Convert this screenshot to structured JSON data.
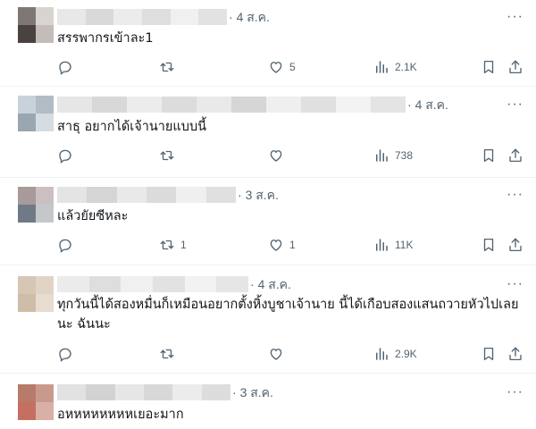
{
  "posts": [
    {
      "time": "4 ส.ค.",
      "text": "สรรพากรเข้าละ1",
      "replies": "",
      "reposts": "",
      "likes": "5",
      "views": "2.1K",
      "avatar_colors": [
        "#7f7774",
        "#d8d4cf",
        "#4b423f",
        "#c3bcb8"
      ]
    },
    {
      "time": "4 ส.ค.",
      "text": "สาธุ อยากได้เจ้านายแบบนี้",
      "replies": "",
      "reposts": "",
      "likes": "",
      "views": "738",
      "avatar_colors": [
        "#c9d2d9",
        "#b2bcc4",
        "#9aa6b0",
        "#d6dde2"
      ]
    },
    {
      "time": "3 ส.ค.",
      "text": "แล้วยัยซีหละ",
      "replies": "",
      "reposts": "1",
      "likes": "1",
      "views": "11K",
      "avatar_colors": [
        "#a79a98",
        "#cbbfc1",
        "#707a86",
        "#c5c8cb"
      ]
    },
    {
      "time": "4 ส.ค.",
      "text_lines": [
        "ทุกวันนี้ได้สองหมื่นก็เหมือนอยากตั้งหิ้งบูชาเจ้านาย นี้ได้เกือบสองแสนถวายหัวไปเลย",
        "นะ ฉันนะ"
      ],
      "replies": "",
      "reposts": "",
      "likes": "",
      "views": "2.9K",
      "avatar_colors": [
        "#d7c6b4",
        "#e2d4c5",
        "#cfbda9",
        "#e7dcd0"
      ]
    },
    {
      "time": "3 ส.ค.",
      "text": "อหหหหหหหหเยอะมาก",
      "avatar_colors": [
        "#b87a6a",
        "#c99a8c",
        "#c46f61",
        "#d9b0a5"
      ]
    }
  ],
  "icons": {
    "reply": "reply-icon",
    "repost": "repost-icon",
    "like": "heart-icon",
    "views": "views-chart-icon",
    "bookmark": "bookmark-icon",
    "share": "share-icon",
    "more": "more-options-icon"
  },
  "more_glyph": "···",
  "colors": {
    "text": "#0f1419",
    "secondary": "#536471",
    "divider": "#eff3f4"
  }
}
